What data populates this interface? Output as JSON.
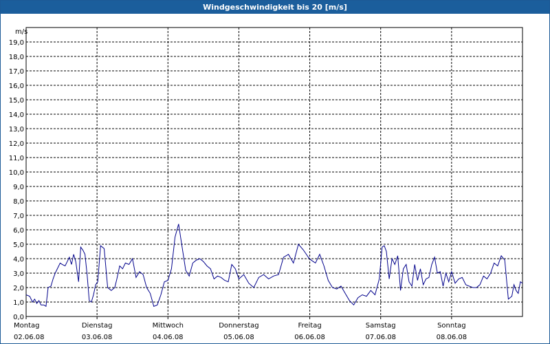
{
  "window": {
    "title": "Windgeschwindigkeit bis 20 [m/s]"
  },
  "chart_data": {
    "type": "line",
    "title": "Windgeschwindigkeit bis 20 [m/s]",
    "ylabel": "m/s",
    "ylim": [
      0,
      20
    ],
    "y_ticks": [
      "0,0",
      "1,0",
      "2,0",
      "3,0",
      "4,0",
      "5,0",
      "6,0",
      "7,0",
      "8,0",
      "9,0",
      "10,0",
      "11,0",
      "12,0",
      "13,0",
      "14,0",
      "15,0",
      "16,0",
      "17,0",
      "18,0",
      "19,0"
    ],
    "x_categories": [
      {
        "day": "Montag",
        "date": "02.06.08"
      },
      {
        "day": "Dienstag",
        "date": "03.06.08"
      },
      {
        "day": "Mittwoch",
        "date": "04.06.08"
      },
      {
        "day": "Donnerstag",
        "date": "05.06.08"
      },
      {
        "day": "Freitag",
        "date": "06.06.08"
      },
      {
        "day": "Samstag",
        "date": "07.06.08"
      },
      {
        "day": "Sonntag",
        "date": "08.06.08"
      }
    ],
    "xlim": [
      0,
      7
    ],
    "grid": true,
    "line_color": "#00008b",
    "series": [
      {
        "x": [
          0.0,
          0.05,
          0.09,
          0.12,
          0.15,
          0.18,
          0.21,
          0.25,
          0.28,
          0.31,
          0.35,
          0.38,
          0.41,
          0.45,
          0.48,
          0.51,
          0.55,
          0.58,
          0.61,
          0.64,
          0.67,
          0.7,
          0.74,
          0.77,
          0.8,
          0.83,
          0.86,
          0.89,
          0.92,
          0.95,
          0.98,
          1.01,
          1.05,
          1.1,
          1.15,
          1.2,
          1.25,
          1.28,
          1.32,
          1.36,
          1.4,
          1.45,
          1.5,
          1.55,
          1.6,
          1.65,
          1.7,
          1.75,
          1.8,
          1.85,
          1.9,
          1.95,
          2.0,
          2.05,
          2.1,
          2.15,
          2.2,
          2.25,
          2.3,
          2.35,
          2.4,
          2.45,
          2.5,
          2.55,
          2.6,
          2.65,
          2.7,
          2.75,
          2.8,
          2.85,
          2.9,
          2.95,
          3.0,
          3.07,
          3.14,
          3.21,
          3.28,
          3.35,
          3.42,
          3.49,
          3.56,
          3.63,
          3.7,
          3.77,
          3.84,
          3.91,
          3.98,
          4.02,
          4.08,
          4.14,
          4.2,
          4.26,
          4.32,
          4.38,
          4.44,
          4.5,
          4.56,
          4.62,
          4.68,
          4.74,
          4.8,
          4.86,
          4.92,
          4.98,
          5.02,
          5.05,
          5.08,
          5.12,
          5.16,
          5.2,
          5.24,
          5.28,
          5.32,
          5.36,
          5.4,
          5.44,
          5.48,
          5.52,
          5.56,
          5.6,
          5.64,
          5.68,
          5.72,
          5.76,
          5.8,
          5.84,
          5.88,
          5.92,
          5.96,
          6.0,
          6.05,
          6.1,
          6.15,
          6.2,
          6.25,
          6.3,
          6.35,
          6.4,
          6.45,
          6.5,
          6.55,
          6.6,
          6.65,
          6.7,
          6.75,
          6.8,
          6.85,
          6.88,
          6.91,
          6.94,
          6.97,
          7.0
        ],
        "y": [
          1.5,
          1.4,
          1.0,
          1.2,
          0.9,
          1.1,
          0.8,
          0.8,
          0.7,
          2.0,
          2.1,
          2.6,
          3.0,
          3.4,
          3.7,
          3.6,
          3.5,
          3.8,
          4.1,
          3.6,
          4.3,
          3.8,
          2.4,
          4.8,
          4.6,
          4.3,
          2.9,
          1.1,
          1.0,
          1.5,
          2.2,
          2.4,
          4.9,
          4.7,
          2.0,
          1.8,
          2.0,
          2.6,
          3.5,
          3.3,
          3.7,
          3.6,
          4.0,
          2.7,
          3.1,
          2.9,
          2.0,
          1.6,
          0.7,
          0.8,
          1.5,
          2.4,
          2.5,
          3.3,
          5.5,
          6.4,
          4.8,
          3.2,
          2.8,
          3.7,
          3.9,
          4.0,
          3.8,
          3.5,
          3.3,
          2.6,
          2.8,
          2.7,
          2.5,
          2.4,
          3.6,
          3.3,
          2.6,
          2.9,
          2.3,
          2.0,
          2.7,
          2.9,
          2.6,
          2.8,
          2.9,
          4.1,
          4.3,
          3.7,
          5.0,
          4.6,
          4.1,
          3.9,
          3.7,
          4.3,
          3.5,
          2.5,
          2.0,
          1.9,
          2.1,
          1.6,
          1.1,
          0.8,
          1.3,
          1.5,
          1.4,
          1.8,
          1.5,
          2.6,
          4.8,
          4.9,
          4.5,
          2.6,
          4.0,
          3.6,
          4.2,
          1.8,
          3.3,
          3.6,
          2.4,
          2.1,
          3.6,
          2.5,
          3.3,
          2.2,
          2.6,
          2.7,
          3.6,
          4.1,
          3.0,
          3.1,
          2.1,
          3.0,
          2.4,
          3.1,
          2.3,
          2.6,
          2.7,
          2.2,
          2.1,
          2.0,
          2.0,
          2.2,
          2.8,
          2.6,
          3.0,
          3.7,
          3.5,
          4.2,
          3.9,
          1.2,
          1.4,
          2.2,
          1.8,
          1.6,
          2.4,
          2.3
        ]
      }
    ]
  }
}
